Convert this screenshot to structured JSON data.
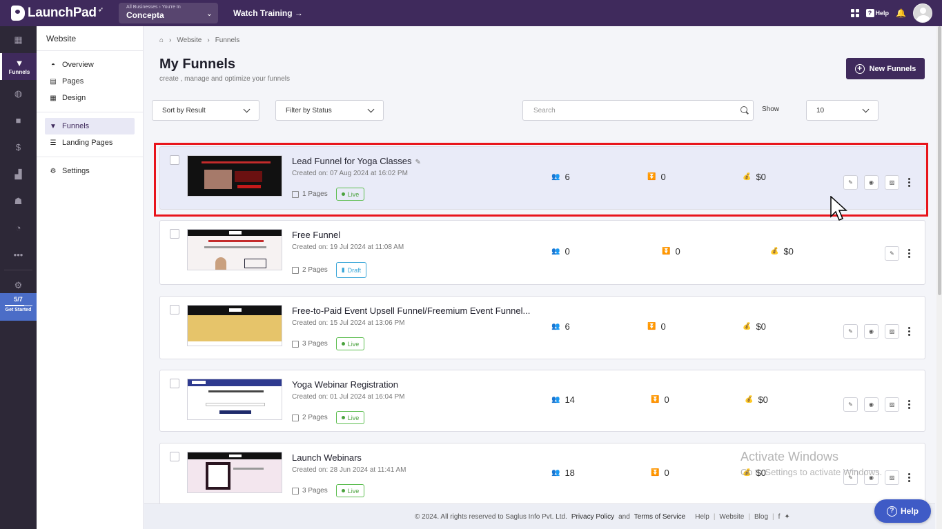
{
  "app": {
    "name": "LaunchPad"
  },
  "topbar": {
    "biz_small": "All Businesses › You're In",
    "biz_name": "Concepta",
    "watch_training": "Watch Training →",
    "help": "Help"
  },
  "rail": {
    "funnels_label": "Funnels",
    "progress": "5/7",
    "get_started": "Get Started",
    "progress_fraction": 0.71
  },
  "subside": {
    "title": "Website",
    "items": [
      {
        "label": "Overview"
      },
      {
        "label": "Pages"
      },
      {
        "label": "Design"
      },
      {
        "label": "Funnels"
      },
      {
        "label": "Landing Pages"
      },
      {
        "label": "Settings"
      }
    ]
  },
  "breadcrumb": {
    "items": [
      "Website",
      "Funnels"
    ]
  },
  "page": {
    "title": "My Funnels",
    "subtitle": "create , manage and optimize your funnels",
    "new_button": "New Funnels"
  },
  "filters": {
    "sort": "Sort by Result",
    "status": "Filter by Status",
    "search_placeholder": "Search",
    "show_label": "Show",
    "show_value": "10"
  },
  "funnels": [
    {
      "name": "Lead Funnel for Yoga Classes",
      "created_label": "Created on:",
      "created": "07 Aug 2024 at 16:02 PM",
      "pages": "1 Pages",
      "status": "Live",
      "visitors": "6",
      "conversions": "0",
      "revenue": "$0"
    },
    {
      "name": "Free Funnel",
      "created_label": "Created on:",
      "created": "19 Jul 2024 at 11:08 AM",
      "pages": "2 Pages",
      "status": "Draft",
      "visitors": "0",
      "conversions": "0",
      "revenue": "$0"
    },
    {
      "name": "Free-to-Paid Event Upsell Funnel/Freemium Event Funnel...",
      "created_label": "Created on:",
      "created": "15 Jul 2024 at 13:06 PM",
      "pages": "3 Pages",
      "status": "Live",
      "visitors": "6",
      "conversions": "0",
      "revenue": "$0"
    },
    {
      "name": "Yoga Webinar Registration",
      "created_label": "Created on:",
      "created": "01 Jul 2024 at 16:04 PM",
      "pages": "2 Pages",
      "status": "Live",
      "visitors": "14",
      "conversions": "0",
      "revenue": "$0"
    },
    {
      "name": "Launch Webinars",
      "created_label": "Created on:",
      "created": "28 Jun 2024 at 11:41 AM",
      "pages": "3 Pages",
      "status": "Live",
      "visitors": "18",
      "conversions": "0",
      "revenue": "$0"
    }
  ],
  "footer": {
    "copyright": "©  2024. All rights reserved to Saglus Info Pvt. Ltd.",
    "privacy": "Privacy Policy",
    "and": "and",
    "terms": "Terms of Service",
    "help": "Help",
    "website": "Website",
    "blog": "Blog"
  },
  "help_float": "Help",
  "watermark": {
    "line1": "Activate Windows",
    "line2": "Go to Settings to activate Windows."
  },
  "colors": {
    "brand": "#3f2a5c",
    "live": "#4aa23d",
    "draft": "#39a6d8",
    "highlight": "#e8141b"
  }
}
